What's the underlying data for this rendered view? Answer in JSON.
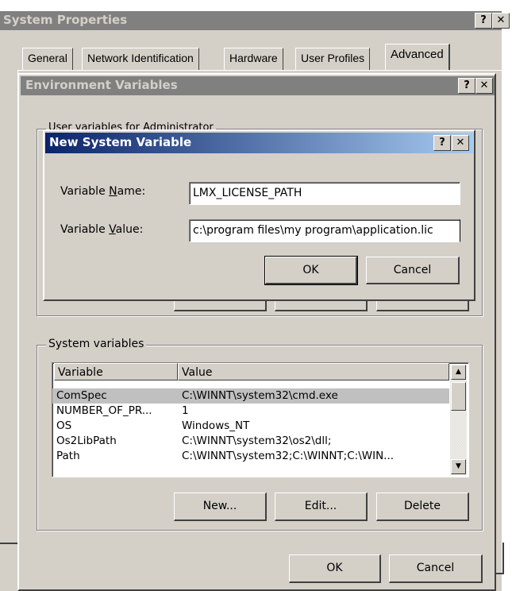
{
  "system_properties": {
    "title": "System Properties",
    "tabs": [
      "General",
      "Network Identification",
      "Hardware",
      "User Profiles",
      "Advanced"
    ],
    "help_label": "?",
    "close_label": "✕"
  },
  "environment_variables": {
    "title": "Environment Variables",
    "help_label": "?",
    "close_label": "✕",
    "user_group_label": "User variables for Administrator",
    "system_group_label": "System variables",
    "columns": [
      "Variable",
      "Value"
    ],
    "rows": [
      {
        "variable": "ComSpec",
        "value": "C:\\WINNT\\system32\\cmd.exe"
      },
      {
        "variable": "NUMBER_OF_PR...",
        "value": "1"
      },
      {
        "variable": "OS",
        "value": "Windows_NT"
      },
      {
        "variable": "Os2LibPath",
        "value": "C:\\WINNT\\system32\\os2\\dll;"
      },
      {
        "variable": "Path",
        "value": "C:\\WINNT\\system32;C:\\WINNT;C:\\WIN..."
      }
    ],
    "buttons": {
      "new": "New...",
      "edit": "Edit...",
      "delete": "Delete"
    },
    "ok": "OK",
    "cancel": "Cancel"
  },
  "new_system_variable": {
    "title": "New System Variable",
    "help_label": "?",
    "close_label": "✕",
    "name_label_pre": "Variable ",
    "name_label_mn": "N",
    "name_label_post": "ame:",
    "value_label_pre": "Variable ",
    "value_label_mn": "V",
    "value_label_post": "alue:",
    "name_value": "LMX_LICENSE_PATH",
    "value_value": "c:\\program files\\my program\\application.lic",
    "ok": "OK",
    "cancel": "Cancel"
  },
  "colors": {
    "dialog_face": "#d4d0c8",
    "active_title": "#0a246a",
    "inactive_title": "#808080",
    "selection": "#c0c0c0"
  }
}
